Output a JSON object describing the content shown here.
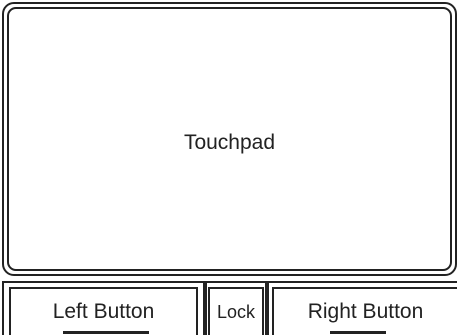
{
  "touchpad": {
    "label": "Touchpad"
  },
  "buttons": {
    "left_label": "Left Button",
    "lock_label": "Lock",
    "right_label": "Right Button"
  }
}
